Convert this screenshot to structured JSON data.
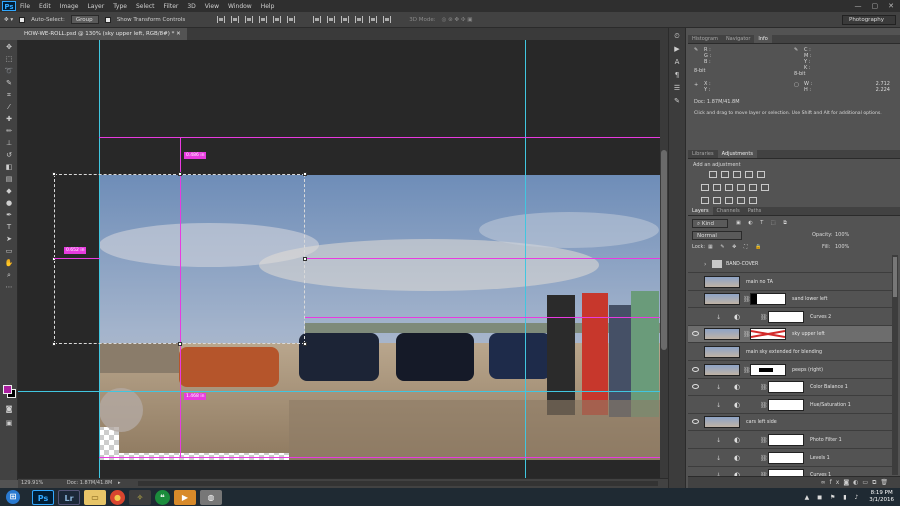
{
  "app": {
    "logo": "Ps"
  },
  "menu": [
    "File",
    "Edit",
    "Image",
    "Layer",
    "Type",
    "Select",
    "Filter",
    "3D",
    "View",
    "Window",
    "Help"
  ],
  "window_controls": [
    "—",
    "▢",
    "✕"
  ],
  "options": {
    "auto_select_label": "Auto-Select:",
    "auto_select_value": "Group",
    "transform_label": "Show Transform Controls",
    "mode_3d": "3D Mode:",
    "workspace": "Photography"
  },
  "document": {
    "tab_title": "HOW-WE-ROLL.psd @ 130% (sky upper left, RGB/8#) *",
    "status_zoom": "129.91%",
    "status_doc": "Doc: 1.87M/41.8M"
  },
  "measurements": {
    "top": "0.486 in",
    "left": "0.652 in",
    "bottom": "1.468 in"
  },
  "info_panel": {
    "tabs": [
      "Histogram",
      "Navigator",
      "Info"
    ],
    "r_label": "R :",
    "g_label": "G :",
    "b_label": "B :",
    "c_label": "C :",
    "m_label": "M :",
    "y_label": "Y :",
    "k_label": "K :",
    "bits_left": "8-bit",
    "bits_right": "8-bit",
    "x_label": "X :",
    "y_label2": "Y :",
    "w_label": "W :",
    "h_label": "H :",
    "w_value": "2.712",
    "h_value": "2.224",
    "doc": "Doc: 1.87M/41.8M",
    "hint": "Click and drag to move layer or selection. Use Shift and Alt for additional options."
  },
  "adjustments_panel": {
    "tabs": [
      "Libraries",
      "Adjustments"
    ],
    "heading": "Add an adjustment"
  },
  "layers_panel": {
    "tabs": [
      "Layers",
      "Channels",
      "Paths"
    ],
    "filter_kind": "Kind",
    "blend_mode": "Normal",
    "opacity_label": "Opacity:",
    "opacity_value": "100%",
    "lock_label": "Lock:",
    "fill_label": "Fill:",
    "fill_value": "100%",
    "layers": [
      {
        "name": "BAND-COVER",
        "kind": "group",
        "visible": false
      },
      {
        "name": "main no TA",
        "kind": "photo",
        "visible": false
      },
      {
        "name": "sand lower left",
        "kind": "masked",
        "visible": false
      },
      {
        "name": "Curves 2",
        "kind": "adjust",
        "icon": "curves-icon",
        "visible": false
      },
      {
        "name": "sky upper left",
        "kind": "masked-red",
        "visible": true,
        "selected": true
      },
      {
        "name": "main sky extended for blending",
        "kind": "photo",
        "visible": false
      },
      {
        "name": "peeps (right)",
        "kind": "masked-black",
        "visible": true
      },
      {
        "name": "Color Balance 1",
        "kind": "adjust",
        "icon": "color-balance-icon",
        "visible": true
      },
      {
        "name": "Hue/Saturation 1",
        "kind": "adjust",
        "icon": "hue-saturation-icon",
        "visible": false
      },
      {
        "name": "cars left side",
        "kind": "photo",
        "visible": true
      },
      {
        "name": "Photo Filter 1",
        "kind": "adjust",
        "icon": "photo-filter-icon",
        "visible": false
      },
      {
        "name": "Levels 1",
        "kind": "adjust",
        "icon": "levels-icon",
        "visible": false
      },
      {
        "name": "Curves 1",
        "kind": "adjust",
        "icon": "curves-icon",
        "visible": false
      }
    ]
  },
  "taskbar": {
    "apps": [
      "Ps",
      "Lr"
    ],
    "time": "8:19 PM",
    "date": "3/1/2016"
  },
  "colors": {
    "guide": "#41c6e0",
    "smart_guide": "#e83be0",
    "foreground": "#ab1fa0",
    "background": "#000000"
  }
}
